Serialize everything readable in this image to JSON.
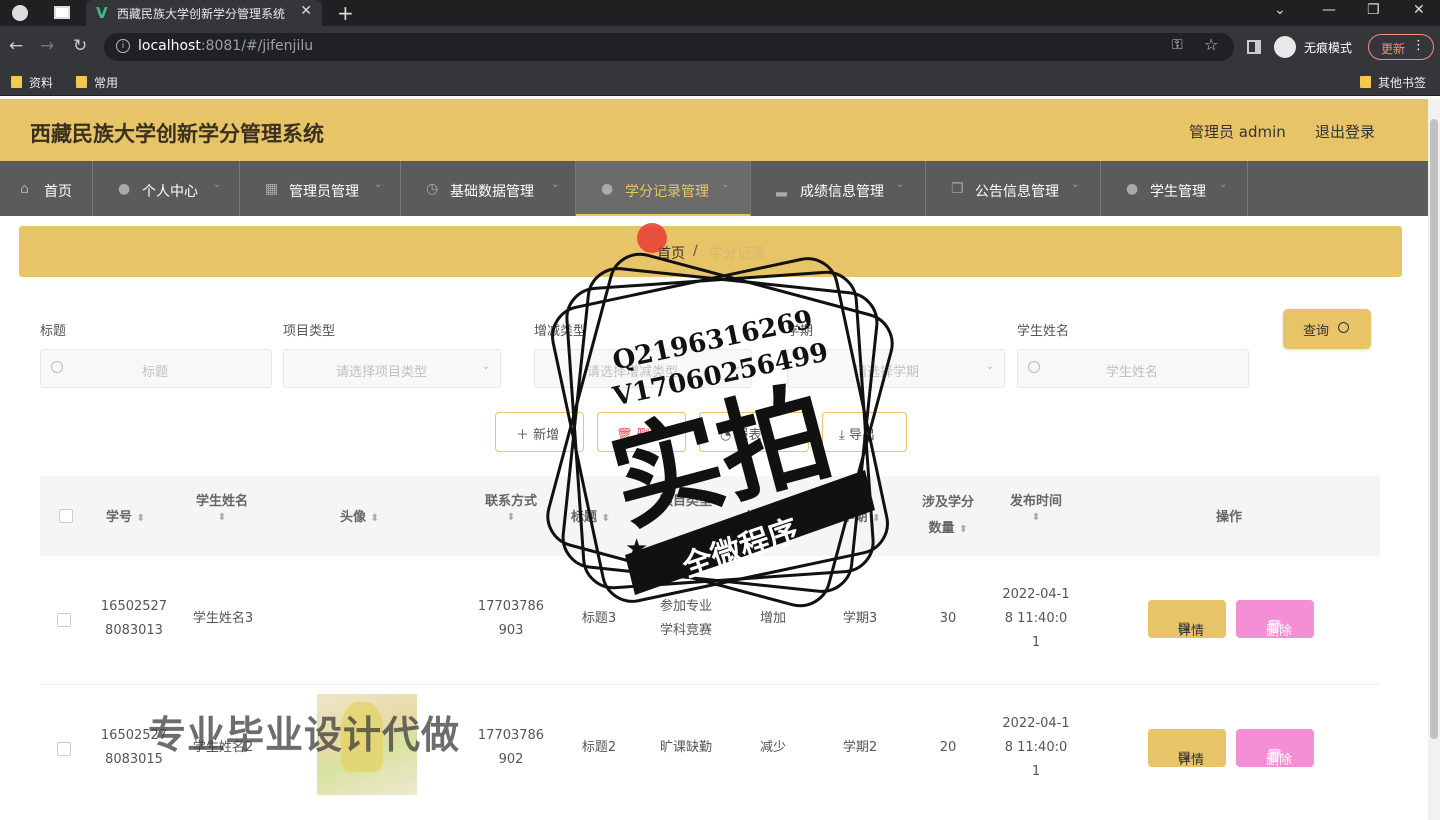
{
  "browser": {
    "tab_title": "西藏民族大学创新学分管理系统",
    "url_host": "localhost",
    "url_rest": ":8081/#/jifenjilu",
    "incognito_label": "无痕模式",
    "update_label": "更新",
    "bookmarks": [
      "资料",
      "常用"
    ],
    "other_bookmarks": "其他书签"
  },
  "header": {
    "title": "西藏民族大学创新学分管理系统",
    "user": "管理员 admin",
    "logout": "退出登录"
  },
  "nav": {
    "items": [
      {
        "label": "首页"
      },
      {
        "label": "个人中心"
      },
      {
        "label": "管理员管理"
      },
      {
        "label": "基础数据管理"
      },
      {
        "label": "学分记录管理"
      },
      {
        "label": "成绩信息管理"
      },
      {
        "label": "公告信息管理"
      },
      {
        "label": "学生管理"
      }
    ]
  },
  "breadcrumb": {
    "home": "首页",
    "sep": "/",
    "current": "学分记录"
  },
  "filters": {
    "title_label": "标题",
    "title_placeholder": "标题",
    "type_label": "项目类型",
    "type_placeholder": "请选择项目类型",
    "change_label": "增减类型",
    "change_placeholder": "请选择增减类型",
    "term_label": "学期",
    "term_placeholder": "请选择学期",
    "name_label": "学生姓名",
    "name_placeholder": "学生姓名",
    "query_label": "查询"
  },
  "actions": {
    "add": "新增",
    "delete": "删除",
    "report": "报表",
    "export": "导出"
  },
  "table": {
    "headers": {
      "student_no": "学号",
      "student_name": "学生姓名",
      "avatar": "头像",
      "phone": "联系方式",
      "title": "标题",
      "project_type": "项目类型",
      "change_type": "增减类型",
      "term": "学期",
      "credits": "涉及学分数量",
      "publish_time": "发布时间",
      "operation": "操作"
    },
    "rows": [
      {
        "student_no": "165025278083013",
        "student_name": "学生姓名3",
        "phone": "17703786903",
        "title": "标题3",
        "project_type": "参加专业学科竞赛",
        "change_type": "增加",
        "term": "学期3",
        "credits": "30",
        "publish_time": "2022-04-18 11:40:01"
      },
      {
        "student_no": "165025278083015",
        "student_name": "学生姓名2",
        "phone": "17703786902",
        "title": "标题2",
        "project_type": "旷课缺勤",
        "change_type": "减少",
        "term": "学期2",
        "credits": "20",
        "publish_time": "2022-04-18 11:40:01"
      }
    ],
    "detail_label": "详情",
    "delete_label": "删除"
  },
  "overlay": {
    "stamp_q": "Q2196316269",
    "stamp_v": "V17060256499",
    "stamp_big": "实拍",
    "stamp_banner": "全微程序",
    "watermark": "专业毕业设计代做"
  }
}
